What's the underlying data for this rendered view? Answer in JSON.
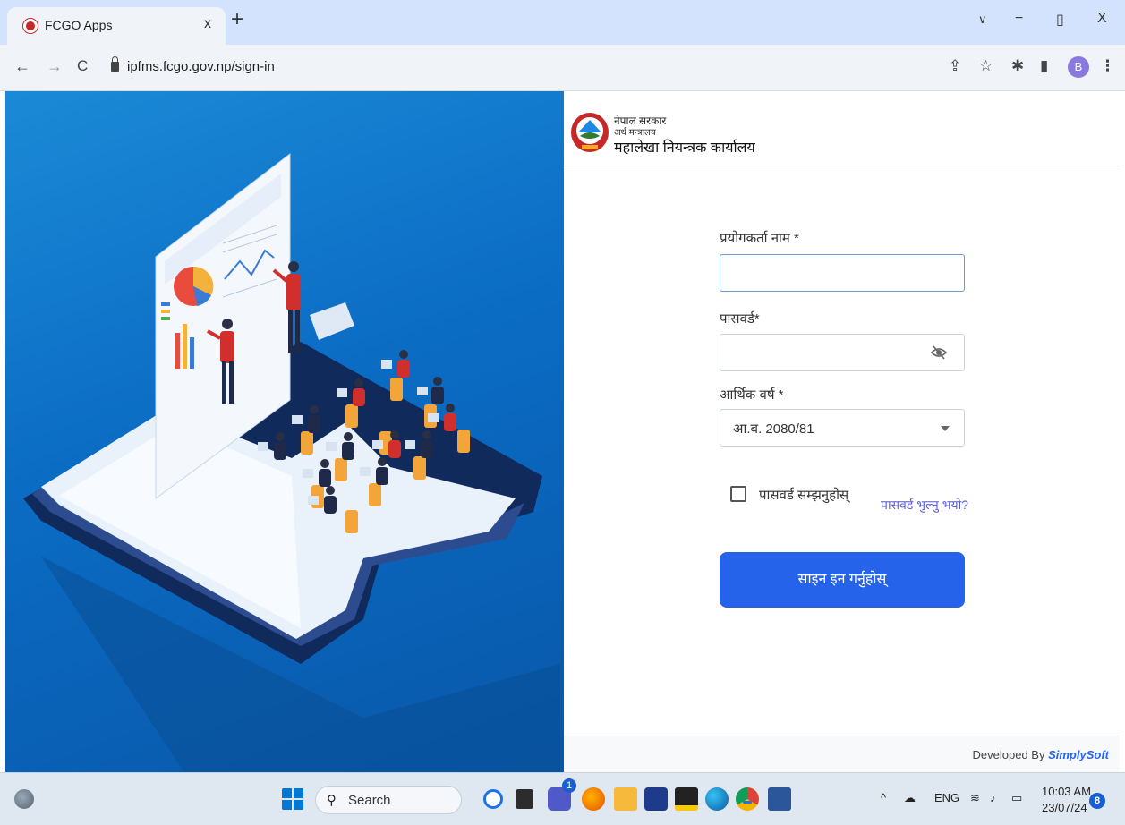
{
  "browser": {
    "tab_title": "FCGO Apps",
    "tab_close": "x",
    "new_tab": "+",
    "url": "ipfms.fcgo.gov.np/sign-in",
    "profile_initial": "B",
    "window_controls": {
      "dropdown": "∨",
      "minimize": "−",
      "restore": "▯",
      "close": "X"
    },
    "nav": {
      "back": "←",
      "forward": "→",
      "reload": "C"
    }
  },
  "brand": {
    "line1": "नेपाल सरकार",
    "line2": "अर्थ मन्त्रालय",
    "line3": "महालेखा नियन्त्रक कार्यालय"
  },
  "form": {
    "username_label": "प्रयोगकर्ता नाम *",
    "username_value": "",
    "password_label": "पासवर्ड*",
    "password_value": "",
    "fiscal_year_label": "आर्थिक वर्ष *",
    "fiscal_year_value": "आ.ब. 2080/81",
    "remember_label": "पासवर्ड सम्झनुहोस्",
    "remember_checked": false,
    "forgot_link": "पासवर्ड भुल्नु भयो?",
    "signin_button": "साइन इन गर्नुहोस्"
  },
  "footer": {
    "developed_by": "Developed By",
    "company": "SimplySoft"
  },
  "taskbar": {
    "search_placeholder": "Search",
    "teams_badge": "1",
    "language": "ENG",
    "time": "10:03 AM",
    "date": "23/07/24",
    "notification_count": "8",
    "tray_chevron": "^"
  },
  "colors": {
    "primary": "#2563eb",
    "hero_blue": "#0b6cc4",
    "link": "#5b5bd6"
  }
}
